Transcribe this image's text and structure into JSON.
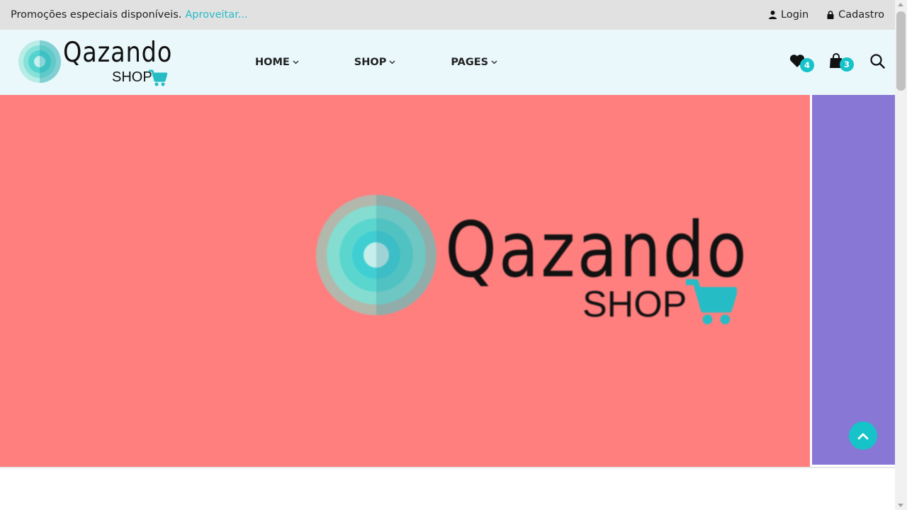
{
  "topbar": {
    "promo_text": "Promoções especiais disponíveis.",
    "promo_link": "Aproveitar...",
    "login_label": "Login",
    "register_label": "Cadastro"
  },
  "header": {
    "logo": {
      "wordmark": "Qazando",
      "subtext": "SHOP"
    },
    "nav": [
      {
        "label": "HOME"
      },
      {
        "label": "SHOP"
      },
      {
        "label": "PAGES"
      }
    ],
    "wishlist_count": "4",
    "cart_count": "3"
  },
  "hero": {
    "main_color": "#ff7f7f",
    "side_color": "#8877d5",
    "logo": {
      "wordmark": "Qazando",
      "subtext": "SHOP"
    }
  },
  "colors": {
    "accent": "#16c3c9",
    "topbar_bg": "#e1e1e1",
    "header_bg": "#eaf8fb"
  },
  "icons": [
    "user-icon",
    "lock-icon",
    "chevron-down-icon",
    "heart-icon",
    "shopping-bag-icon",
    "search-icon",
    "cart-icon",
    "arrow-up-icon"
  ]
}
